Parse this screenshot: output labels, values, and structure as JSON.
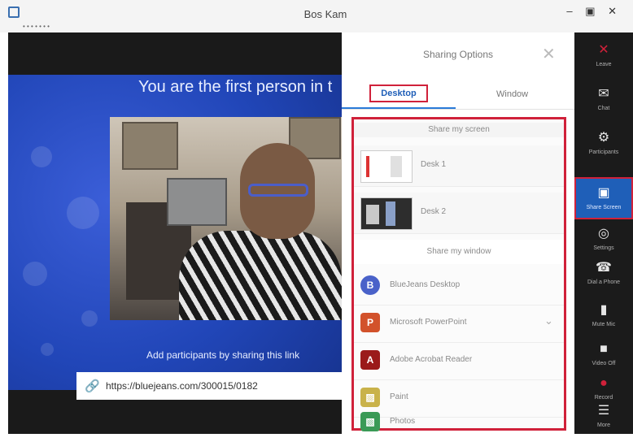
{
  "window": {
    "title": "Bos Kam",
    "sub_label": "• • • • • • •",
    "controls": "– ▣ ✕"
  },
  "meeting": {
    "first_person_message": "You are the first person in t",
    "add_participants_message": "Add participants by sharing this link",
    "meeting_link": "https://bluejeans.com/300015/0182"
  },
  "share_panel": {
    "title": "Sharing Options",
    "tabs": [
      {
        "label": "Desktop",
        "selected": true
      },
      {
        "label": "Window",
        "selected": false
      }
    ],
    "sections": [
      {
        "heading": "Share my screen",
        "items": [
          {
            "label": "Desk 1"
          },
          {
            "label": "Desk 2"
          }
        ]
      },
      {
        "heading": "Share my window",
        "items": [
          {
            "label": "BlueJeans Desktop",
            "icon": "B",
            "color": "#4a62c9"
          },
          {
            "label": "Microsoft PowerPoint",
            "icon": "P",
            "color": "#d2522b"
          },
          {
            "label": "Adobe Acrobat Reader",
            "icon": "A",
            "color": "#9b1a1a"
          },
          {
            "label": "Paint",
            "icon": "▨",
            "color": "#c9b24a"
          },
          {
            "label": "Photos",
            "icon": "▧",
            "color": "#3a9a56"
          }
        ]
      }
    ]
  },
  "sidebar": {
    "items": [
      {
        "name": "leave",
        "label": "Leave",
        "icon": "✕",
        "color": "#d0213a"
      },
      {
        "name": "chat",
        "label": "Chat",
        "icon": "✉",
        "color": "#e6e6e6"
      },
      {
        "name": "participants",
        "label": "Participants",
        "icon": "⚙",
        "color": "#e6e6e6"
      },
      {
        "name": "share-screen",
        "label": "Share Screen",
        "icon": "▣",
        "color": "#ffffff",
        "active": true
      },
      {
        "name": "settings",
        "label": "Settings",
        "icon": "◎",
        "color": "#e6e6e6"
      },
      {
        "name": "dial-phone",
        "label": "Dial a Phone",
        "icon": "☎",
        "color": "#e6e6e6"
      },
      {
        "name": "mute-mic",
        "label": "Mute Mic",
        "icon": "▮",
        "color": "#e6e6e6"
      },
      {
        "name": "video-off",
        "label": "Video Off",
        "icon": "■",
        "color": "#e6e6e6"
      },
      {
        "name": "record",
        "label": "Record",
        "icon": "●",
        "color": "#d0213a"
      },
      {
        "name": "more",
        "label": "More",
        "icon": "☰",
        "color": "#e6e6e6"
      }
    ]
  },
  "colors": {
    "accent_red": "#d0213a",
    "brand_blue": "#1f5fb8"
  }
}
